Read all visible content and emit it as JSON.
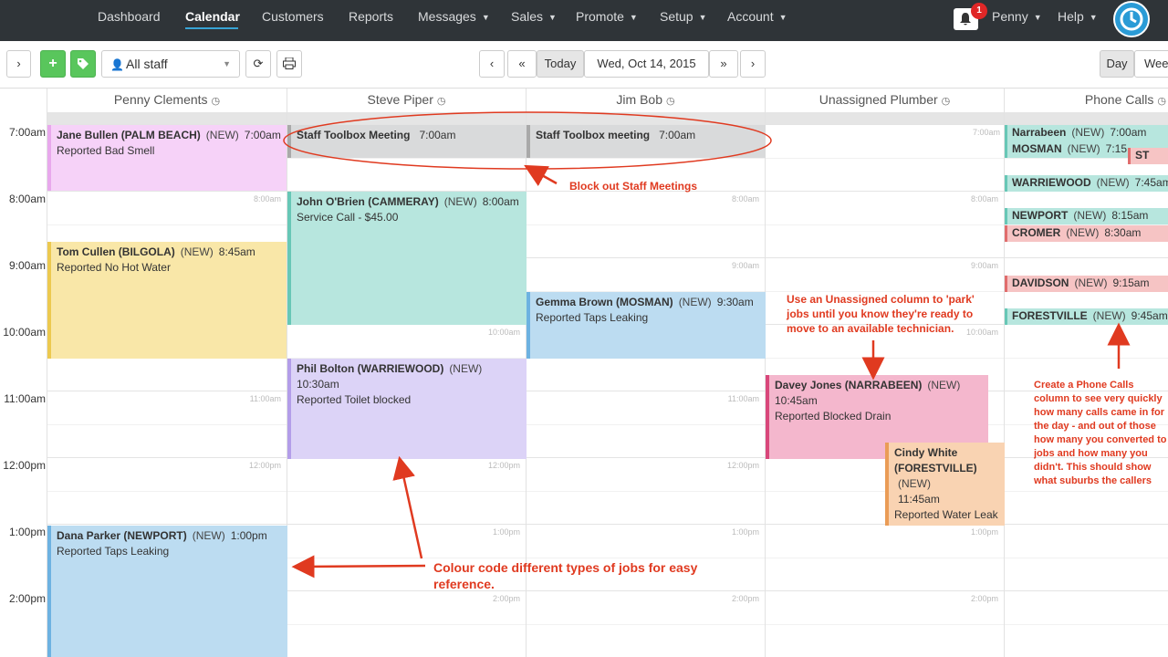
{
  "nav": {
    "items": [
      {
        "label": "Dashboard"
      },
      {
        "label": "Calendar"
      },
      {
        "label": "Customers"
      },
      {
        "label": "Reports"
      },
      {
        "label": "Messages"
      },
      {
        "label": "Sales"
      },
      {
        "label": "Promote"
      },
      {
        "label": "Setup"
      },
      {
        "label": "Account"
      }
    ],
    "notifications_count": "1",
    "user": "Penny",
    "help": "Help"
  },
  "toolbar": {
    "staff_filter": "All staff",
    "today": "Today",
    "date": "Wed, Oct 14, 2015",
    "view_day": "Day",
    "view_week": "Wee"
  },
  "columns": [
    {
      "name": "Penny Clements"
    },
    {
      "name": "Steve Piper"
    },
    {
      "name": "Jim Bob"
    },
    {
      "name": "Unassigned Plumber"
    },
    {
      "name": "Phone Calls"
    }
  ],
  "times": [
    "7:00am",
    "8:00am",
    "9:00am",
    "10:00am",
    "11:00am",
    "12:00pm",
    "1:00pm",
    "2:00pm"
  ],
  "events": {
    "jane": {
      "name": "Jane Bullen (PALM BEACH)",
      "status": "(NEW)",
      "time": "7:00am",
      "desc": "Reported Bad Smell"
    },
    "staff1": {
      "name": "Staff Toolbox Meeting",
      "time": "7:00am"
    },
    "staff2": {
      "name": "Staff Toolbox meeting",
      "time": "7:00am"
    },
    "john": {
      "name": "John O'Brien (CAMMERAY)",
      "status": "(NEW)",
      "time": "8:00am",
      "desc": "Service Call - $45.00"
    },
    "tom": {
      "name": "Tom Cullen (BILGOLA)",
      "status": "(NEW)",
      "time": "8:45am",
      "desc": "Reported No Hot Water"
    },
    "gemma": {
      "name": "Gemma Brown (MOSMAN)",
      "status": "(NEW)",
      "time": "9:30am",
      "desc": "Reported Taps Leaking"
    },
    "phil": {
      "name": "Phil Bolton (WARRIEWOOD)",
      "status": "(NEW)",
      "time": "10:30am",
      "desc": "Reported Toilet blocked"
    },
    "davey": {
      "name": "Davey Jones (NARRABEEN)",
      "status": "(NEW)",
      "time": "10:45am",
      "desc": "Reported Blocked Drain"
    },
    "cindy": {
      "name": "Cindy White (FORESTVILLE)",
      "status": "(NEW)",
      "time": "11:45am",
      "desc": "Reported Water Leak"
    },
    "dana": {
      "name": "Dana Parker (NEWPORT)",
      "status": "(NEW)",
      "time": "1:00pm",
      "desc": "Reported Taps Leaking"
    }
  },
  "calls": [
    {
      "name": "Narrabeen",
      "status": "(NEW)",
      "time": "7:00am"
    },
    {
      "name": "MOSMAN",
      "status": "(NEW)",
      "time": "7:15"
    },
    {
      "name": "ST IVES",
      "status": "",
      "time": ""
    },
    {
      "name": "WARRIEWOOD",
      "status": "(NEW)",
      "time": "7:45am"
    },
    {
      "name": "NEWPORT",
      "status": "(NEW)",
      "time": "8:15am"
    },
    {
      "name": "CROMER",
      "status": "(NEW)",
      "time": "8:30am"
    },
    {
      "name": "DAVIDSON",
      "status": "(NEW)",
      "time": "9:15am"
    },
    {
      "name": "FORESTVILLE",
      "status": "(NEW)",
      "time": "9:45am"
    }
  ],
  "annotations": {
    "staff": "Block out Staff Meetings",
    "unassigned": "Use an Unassigned column to 'park' jobs until you know they're ready to move to an available technician.",
    "colour": "Colour code different types of jobs for easy reference.",
    "phone": "Create a Phone Calls column to see very quickly how many calls came in for the day - and out of those how many you converted to jobs and how many you didn't.  This should show what suburbs the callers came from so you can quickly see if marketing to certain areas are working."
  },
  "colors": {
    "accent": "#38a4d6",
    "annotation": "#e03a20",
    "nav_bg": "#2f3438"
  }
}
